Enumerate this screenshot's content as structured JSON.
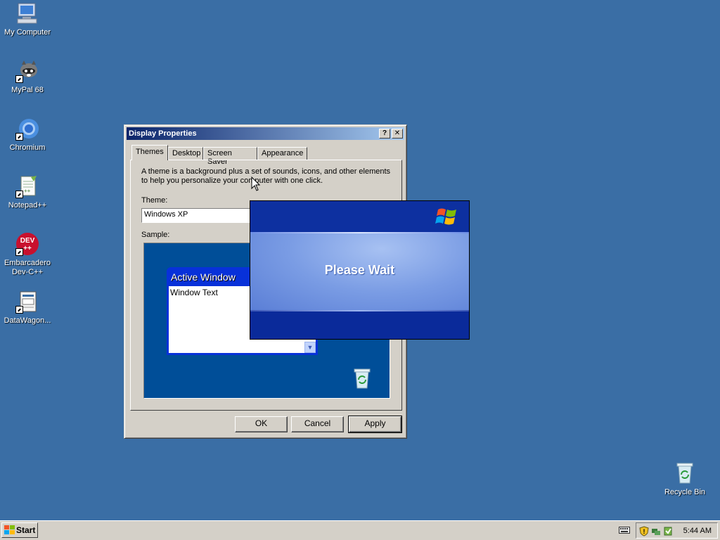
{
  "desktop": {
    "icons": [
      {
        "label": "My Computer"
      },
      {
        "label": "MyPal 68"
      },
      {
        "label": "Chromium"
      },
      {
        "label": "Notepad++"
      },
      {
        "label": "Embarcadero Dev-C++"
      },
      {
        "label": "DataWagon..."
      },
      {
        "label": "Recycle Bin"
      }
    ],
    "background_color": "#3a6ea5"
  },
  "dialog": {
    "title": "Display Properties",
    "help_btn": "?",
    "close_btn": "✕",
    "tabs": [
      {
        "label": "Themes",
        "active": true
      },
      {
        "label": "Desktop"
      },
      {
        "label": "Screen Saver"
      },
      {
        "label": "Appearance"
      }
    ],
    "description": "A theme is a background plus a set of sounds, icons, and other elements to help you personalize your computer with one click.",
    "theme_label": "Theme:",
    "theme_value": "Windows XP",
    "sample_label": "Sample:",
    "sample": {
      "window_title": "Active Window",
      "window_text": "Window Text"
    },
    "buttons": {
      "ok": "OK",
      "cancel": "Cancel",
      "apply": "Apply"
    }
  },
  "please_wait": {
    "message": "Please Wait"
  },
  "taskbar": {
    "start_label": "Start",
    "clock": "5:44 AM"
  }
}
